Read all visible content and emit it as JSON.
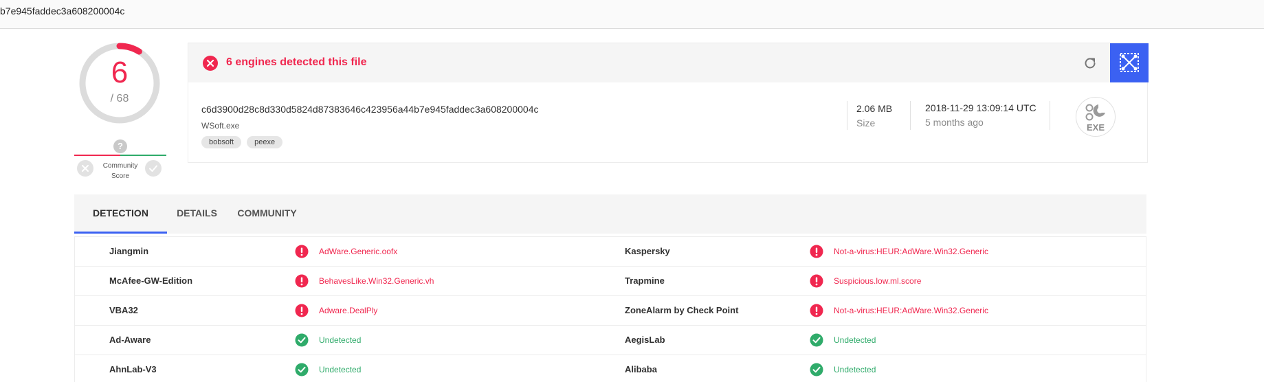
{
  "browser": {
    "url": "b7e945faddec3a608200004c"
  },
  "score": {
    "detected": "6",
    "total": "/ 68",
    "detected_fraction": 0.088
  },
  "community": {
    "help": "?",
    "label": "Community Score"
  },
  "file": {
    "alert": "6 engines detected this file",
    "hash": "c6d3900d28c8d330d5824d87383646c423956a44b7e945faddec3a608200004c",
    "name": "WSoft.exe",
    "tags": [
      "bobsoft",
      "peexe"
    ],
    "size_value": "2.06 MB",
    "size_label": "Size",
    "date_value": "2018-11-29 13:09:14 UTC",
    "date_relative": "5 months ago",
    "type_label": "EXE"
  },
  "tabs": [
    {
      "label": "DETECTION",
      "active": true
    },
    {
      "label": "DETAILS",
      "active": false
    },
    {
      "label": "COMMUNITY",
      "active": false
    }
  ],
  "detections": [
    {
      "left": {
        "engine": "Jiangmin",
        "result": "AdWare.Generic.oofx",
        "status": "malicious"
      },
      "right": {
        "engine": "Kaspersky",
        "result": "Not-a-virus:HEUR:AdWare.Win32.Generic",
        "status": "malicious"
      }
    },
    {
      "left": {
        "engine": "McAfee-GW-Edition",
        "result": "BehavesLike.Win32.Generic.vh",
        "status": "malicious"
      },
      "right": {
        "engine": "Trapmine",
        "result": "Suspicious.low.ml.score",
        "status": "malicious"
      }
    },
    {
      "left": {
        "engine": "VBA32",
        "result": "Adware.DealPly",
        "status": "malicious"
      },
      "right": {
        "engine": "ZoneAlarm by Check Point",
        "result": "Not-a-virus:HEUR:AdWare.Win32.Generic",
        "status": "malicious"
      }
    },
    {
      "left": {
        "engine": "Ad-Aware",
        "result": "Undetected",
        "status": "clean"
      },
      "right": {
        "engine": "AegisLab",
        "result": "Undetected",
        "status": "clean"
      }
    },
    {
      "left": {
        "engine": "AhnLab-V3",
        "result": "Undetected",
        "status": "clean"
      },
      "right": {
        "engine": "Alibaba",
        "result": "Undetected",
        "status": "clean"
      }
    }
  ],
  "colors": {
    "malicious": "#f0274f",
    "clean": "#2fab6a",
    "accent": "#3b61f2"
  }
}
